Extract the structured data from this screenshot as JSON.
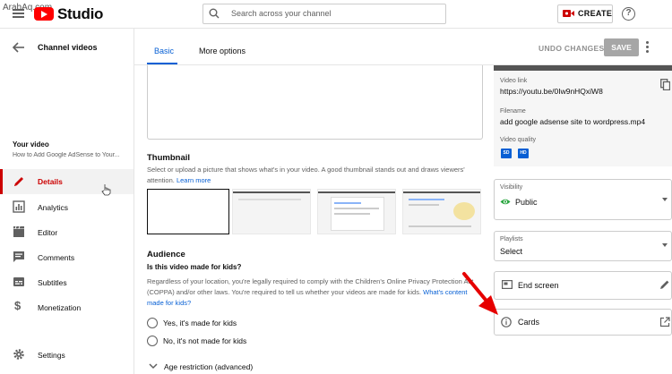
{
  "watermark": "ArabAq.com",
  "header": {
    "brand": "Studio",
    "search_placeholder": "Search across your channel",
    "create_label": "CREATE",
    "help_glyph": "?"
  },
  "sidebar": {
    "back_title": "Channel videos",
    "your_video_label": "Your video",
    "video_title": "How to Add Google AdSense to Your...",
    "items": [
      {
        "label": "Details",
        "icon": "pencil-icon",
        "active": true
      },
      {
        "label": "Analytics",
        "icon": "bar-chart-icon"
      },
      {
        "label": "Editor",
        "icon": "clapperboard-icon"
      },
      {
        "label": "Comments",
        "icon": "comment-icon"
      },
      {
        "label": "Subtitles",
        "icon": "subtitles-icon"
      },
      {
        "label": "Monetization",
        "icon": "dollar-icon"
      }
    ],
    "settings_label": "Settings"
  },
  "tabs": [
    {
      "label": "Basic",
      "active": true
    },
    {
      "label": "More options"
    }
  ],
  "actions": {
    "undo_label": "UNDO CHANGES",
    "save_label": "SAVE"
  },
  "thumbnail": {
    "title": "Thumbnail",
    "description": "Select or upload a picture that shows what's in your video. A good thumbnail stands out and draws viewers' attention.",
    "learn_more": "Learn more"
  },
  "audience": {
    "title": "Audience",
    "question": "Is this video made for kids?",
    "description": "Regardless of your location, you're legally required to comply with the Children's Online Privacy Protection Act (COPPA) and/or other laws. You're required to tell us whether your videos are made for kids.",
    "link": "What's content made for kids?",
    "option_yes": "Yes, it's made for kids",
    "option_no": "No, it's not made for kids",
    "age_restriction": "Age restriction (advanced)"
  },
  "video_info": {
    "link_label": "Video link",
    "link_value": "https://youtu.be/0Iw9nHQxiW8",
    "filename_label": "Filename",
    "filename_value": "add google adsense site to wordpress.mp4",
    "quality_label": "Video quality",
    "quality_badges": [
      "SD",
      "HD"
    ]
  },
  "visibility": {
    "label": "Visibility",
    "value": "Public"
  },
  "playlists": {
    "label": "Playlists",
    "value": "Select"
  },
  "end_screen": {
    "label": "End screen"
  },
  "cards": {
    "label": "Cards"
  },
  "colors": {
    "accent": "#065fd4",
    "active_red": "#cc0000",
    "arrow_red": "#e60000",
    "visibility_green": "#2ba640"
  }
}
